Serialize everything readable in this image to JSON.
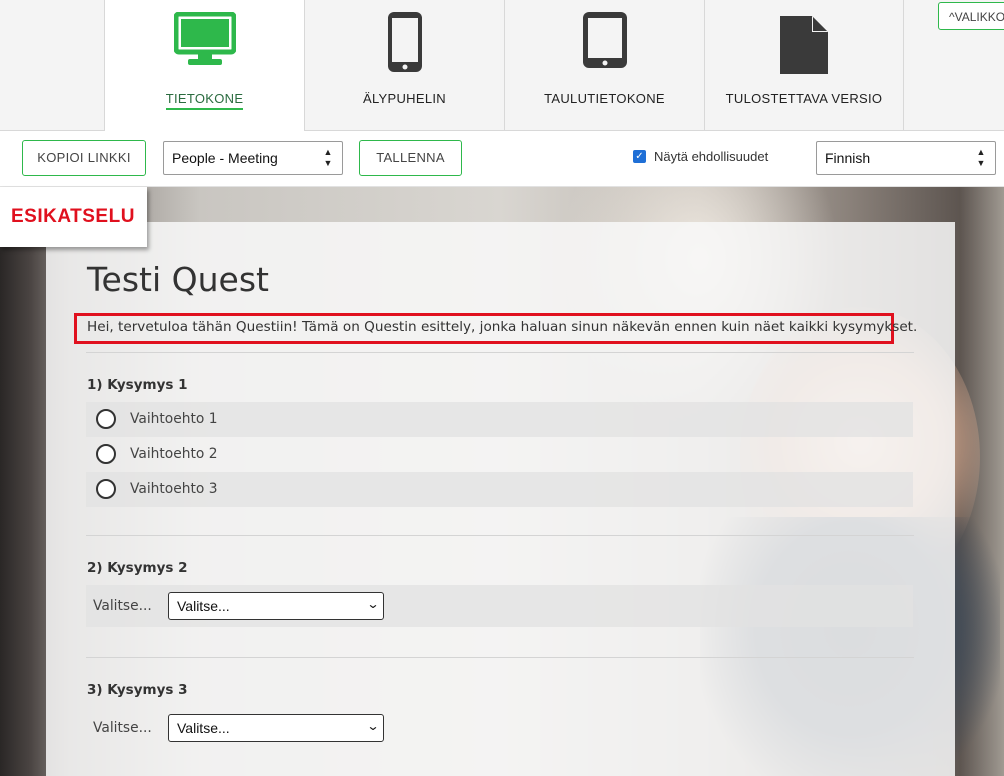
{
  "device_tabs": [
    {
      "label": "TIETOKONE",
      "icon": "desktop-monitor-icon",
      "active": true
    },
    {
      "label": "ÄLYPUHELIN",
      "icon": "smartphone-icon",
      "active": false
    },
    {
      "label": "TAULUTIETOKONE",
      "icon": "tablet-icon",
      "active": false
    },
    {
      "label": "TULOSTETTAVA VERSIO",
      "icon": "document-icon",
      "active": false
    }
  ],
  "menu_button": "^VALIKKO",
  "toolbar": {
    "copy_link": "KOPIOI LINKKI",
    "theme_select": "People - Meeting",
    "save": "TALLENNA",
    "show_conditions_label": "Näytä ehdollisuudet",
    "show_conditions_checked": true,
    "language_select": "Finnish"
  },
  "preview_badge": "ESIKATSELU",
  "colors": {
    "accent": "#2eb84b",
    "highlight": "#e0101e",
    "checkbox": "#1f6fd6"
  },
  "form": {
    "title": "Testi Quest",
    "intro": "Hei, tervetuloa tähän Questiin! Tämä on Questin esittely, jonka haluan sinun näkevän ennen kuin näet kaikki kysymykset.",
    "questions": [
      {
        "heading": "1) Kysymys 1",
        "options": [
          "Vaihtoehto 1",
          "Vaihtoehto 2",
          "Vaihtoehto 3"
        ]
      },
      {
        "heading": "2) Kysymys 2",
        "label": "Valitse...",
        "select_value": "Valitse..."
      },
      {
        "heading": "3) Kysymys 3",
        "label": "Valitse...",
        "select_value": "Valitse..."
      }
    ]
  }
}
